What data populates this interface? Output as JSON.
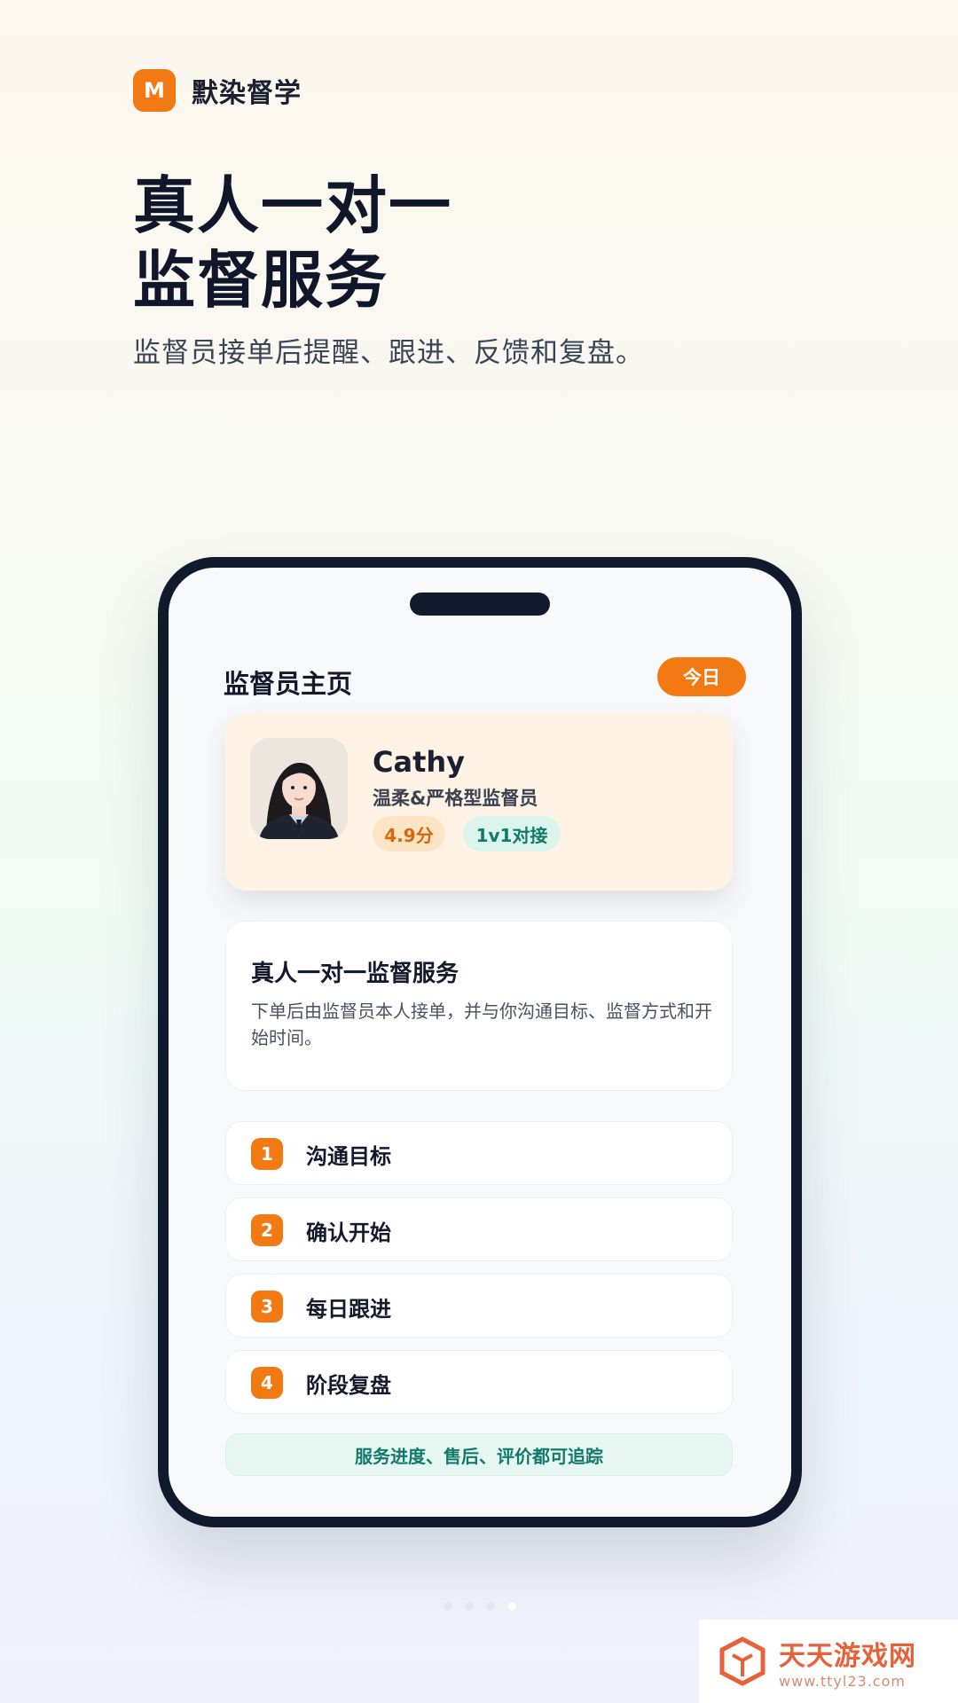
{
  "brand": {
    "logo_letter": "M",
    "name": "默染督学"
  },
  "hero": {
    "title_line1": "真人一对一",
    "title_line2": "监督服务",
    "subtitle": "监督员接单后提醒、跟进、反馈和复盘。"
  },
  "phone": {
    "page_title": "监督员主页",
    "today_label": "今日",
    "profile": {
      "name": "Cathy",
      "role": "温柔&严格型监督员",
      "rating": "4.9分",
      "mode": "1v1对接"
    },
    "intro": {
      "title": "真人一对一监督服务",
      "text": "下单后由监督员本人接单，并与你沟通目标、监督方式和开始时间。"
    },
    "steps": [
      {
        "num": "1",
        "label": "沟通目标"
      },
      {
        "num": "2",
        "label": "确认开始"
      },
      {
        "num": "3",
        "label": "每日跟进"
      },
      {
        "num": "4",
        "label": "阶段复盘"
      }
    ],
    "footer_note": "服务进度、售后、评价都可追踪"
  },
  "pagination": {
    "total": 4,
    "active": 4
  },
  "watermark": {
    "title": "天天游戏网",
    "url": "www.ttyl23.com"
  },
  "colors": {
    "accent": "#f37a12",
    "teal": "#127a6a",
    "dark": "#111a2c"
  }
}
